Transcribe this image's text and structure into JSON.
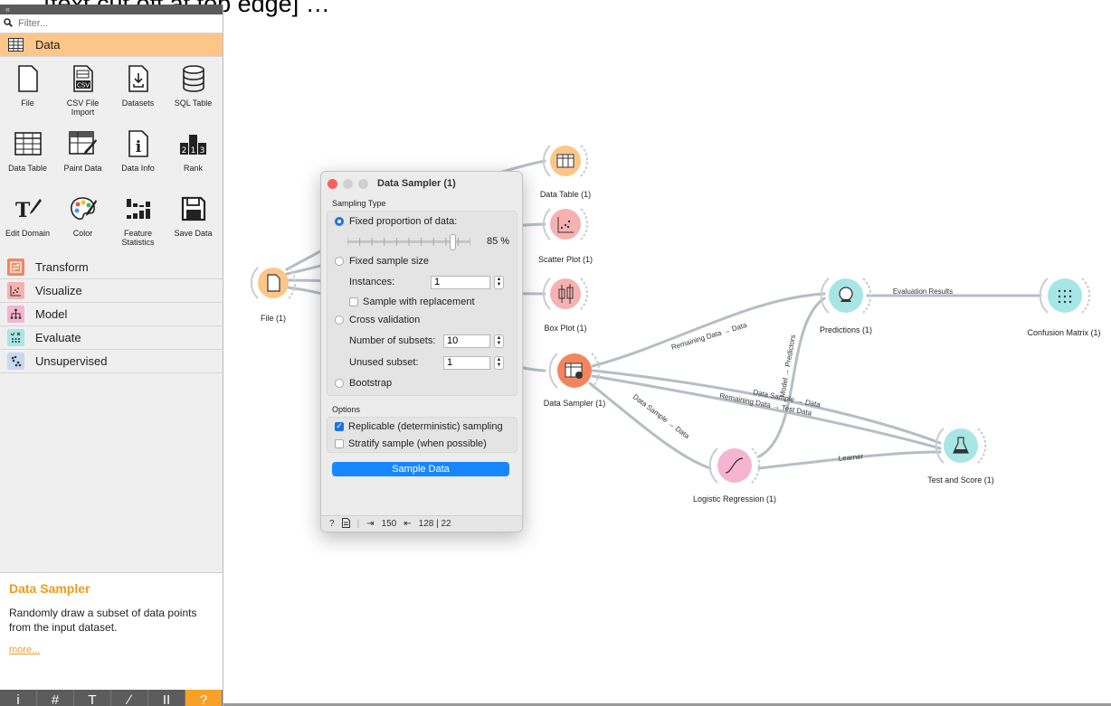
{
  "page_caption": "… [text cut off at top edge] …",
  "panel": {
    "filter_placeholder": "Filter...",
    "categories": [
      {
        "label": "Data",
        "color": "#fcc688",
        "icon": "data-table-icon"
      },
      {
        "label": "Transform",
        "color": "#f3855e",
        "icon": "transform-icon"
      },
      {
        "label": "Visualize",
        "color": "#f6b2b0",
        "icon": "visualize-icon"
      },
      {
        "label": "Model",
        "color": "#f5b4d0",
        "icon": "model-icon"
      },
      {
        "label": "Evaluate",
        "color": "#a7e6e4",
        "icon": "evaluate-icon"
      },
      {
        "label": "Unsupervised",
        "color": "#c8d8f2",
        "icon": "unsupervised-icon"
      }
    ],
    "tools": [
      {
        "label": "File",
        "icon": "file-icon"
      },
      {
        "label": "CSV File Import",
        "icon": "csv-icon"
      },
      {
        "label": "Datasets",
        "icon": "datasets-icon"
      },
      {
        "label": "SQL Table",
        "icon": "database-icon"
      },
      {
        "label": "Data Table",
        "icon": "table-icon"
      },
      {
        "label": "Paint Data",
        "icon": "paint-data-icon"
      },
      {
        "label": "Data Info",
        "icon": "info-icon"
      },
      {
        "label": "Rank",
        "icon": "rank-icon"
      },
      {
        "label": "Edit Domain",
        "icon": "edit-domain-icon"
      },
      {
        "label": "Color",
        "icon": "palette-icon"
      },
      {
        "label": "Feature Statistics",
        "icon": "bar-stats-icon"
      },
      {
        "label": "Save Data",
        "icon": "save-icon"
      }
    ],
    "help": {
      "title": "Data Sampler",
      "text": "Randomly draw a subset of data points from the input dataset.",
      "more": "more..."
    },
    "bottom_buttons": [
      "i",
      "#",
      "T",
      "∕",
      "II",
      "?"
    ]
  },
  "canvas": {
    "nodes": [
      {
        "label": "File (1)",
        "color": "#fcc688"
      },
      {
        "label": "Data Table (1)",
        "color": "#fcc688"
      },
      {
        "label": "Scatter Plot (1)",
        "color": "#f6b2b0"
      },
      {
        "label": "Box Plot (1)",
        "color": "#f6b2b0"
      },
      {
        "label": "Data Sampler (1)",
        "color": "#f3855e"
      },
      {
        "label": "Predictions (1)",
        "color": "#a7e6e4"
      },
      {
        "label": "Confusion Matrix (1)",
        "color": "#a7e6e4"
      },
      {
        "label": "Logistic Regression (1)",
        "color": "#f5b4d0"
      },
      {
        "label": "Test and Score (1)",
        "color": "#a7e6e4"
      }
    ],
    "links": {
      "evaluation_results": "Evaluation Results",
      "remaining_data_predictions": "Remaining Data → Data",
      "model_predictors": "Model → Predictors",
      "data_sample_lr": "Data Sample → Data",
      "data_sample_ts": "Data Sample → Data",
      "remaining_test": "Remaining Data → Test Data",
      "learner": "Learner"
    }
  },
  "dialog": {
    "title": "Data Sampler (1)",
    "sampling_type_label": "Sampling Type",
    "fixed_proportion_label": "Fixed proportion of data:",
    "proportion_value": "85 %",
    "proportion": 85,
    "fixed_size_label": "Fixed sample size",
    "instances_label": "Instances:",
    "instances_value": "1",
    "with_replacement_label": "Sample with replacement",
    "cross_validation_label": "Cross validation",
    "subsets_label": "Number of subsets:",
    "subsets_value": "10",
    "unused_label": "Unused subset:",
    "unused_value": "1",
    "bootstrap_label": "Bootstrap",
    "options_label": "Options",
    "replicable_label": "Replicable (deterministic) sampling",
    "stratify_label": "Stratify sample (when possible)",
    "sample_button": "Sample Data",
    "status_in": "150",
    "status_out": "128 | 22"
  }
}
